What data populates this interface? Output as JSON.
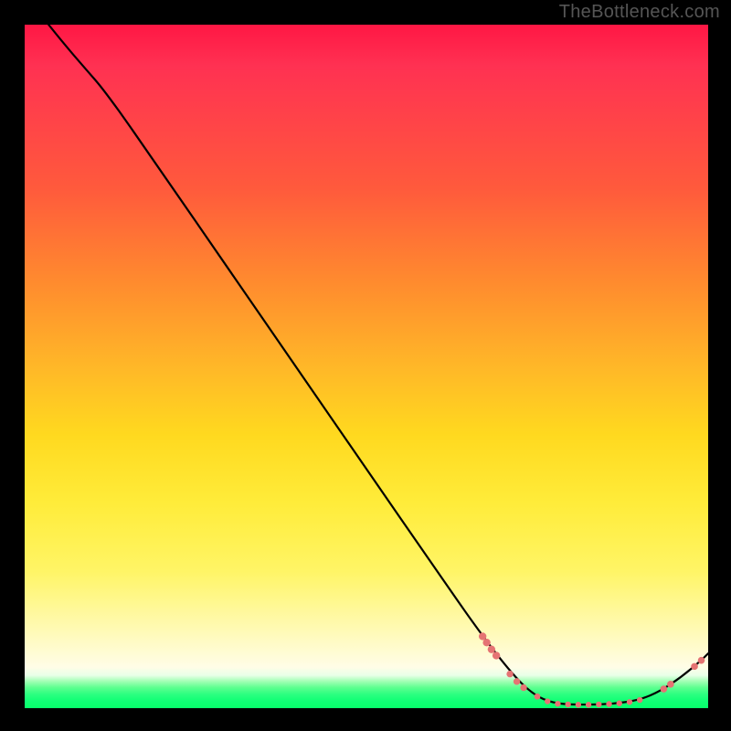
{
  "watermark": "TheBottleneck.com",
  "chart_data": {
    "type": "line",
    "title": "",
    "xlabel": "",
    "ylabel": "",
    "xlim": [
      0,
      100
    ],
    "ylim": [
      0,
      100
    ],
    "grid": false,
    "curve": [
      {
        "x": 3.5,
        "y": 100
      },
      {
        "x": 5.5,
        "y": 97.5
      },
      {
        "x": 8.5,
        "y": 94
      },
      {
        "x": 12,
        "y": 90
      },
      {
        "x": 20,
        "y": 78.5
      },
      {
        "x": 30,
        "y": 64
      },
      {
        "x": 40,
        "y": 49.5
      },
      {
        "x": 50,
        "y": 35
      },
      {
        "x": 60,
        "y": 20.5
      },
      {
        "x": 67,
        "y": 10.5
      },
      {
        "x": 72,
        "y": 4.2
      },
      {
        "x": 75,
        "y": 1.6
      },
      {
        "x": 78,
        "y": 0.6
      },
      {
        "x": 82,
        "y": 0.5
      },
      {
        "x": 86,
        "y": 0.6
      },
      {
        "x": 90,
        "y": 1.2
      },
      {
        "x": 93,
        "y": 2.5
      },
      {
        "x": 96,
        "y": 4.5
      },
      {
        "x": 99,
        "y": 7.0
      },
      {
        "x": 100,
        "y": 8.0
      }
    ],
    "markers": [
      {
        "x": 67.0,
        "y": 10.5,
        "r": 4.2
      },
      {
        "x": 67.6,
        "y": 9.6,
        "r": 4.2
      },
      {
        "x": 68.3,
        "y": 8.6,
        "r": 4.2
      },
      {
        "x": 69.0,
        "y": 7.7,
        "r": 4.2
      },
      {
        "x": 71.0,
        "y": 5.0,
        "r": 3.7
      },
      {
        "x": 72.0,
        "y": 3.9,
        "r": 3.7
      },
      {
        "x": 73.0,
        "y": 3.0,
        "r": 3.7
      },
      {
        "x": 75.0,
        "y": 1.7,
        "r": 3.4
      },
      {
        "x": 76.5,
        "y": 1.0,
        "r": 3.2
      },
      {
        "x": 78.0,
        "y": 0.65,
        "r": 3.2
      },
      {
        "x": 79.5,
        "y": 0.55,
        "r": 3.2
      },
      {
        "x": 81.0,
        "y": 0.5,
        "r": 3.2
      },
      {
        "x": 82.5,
        "y": 0.5,
        "r": 3.2
      },
      {
        "x": 84.0,
        "y": 0.55,
        "r": 3.2
      },
      {
        "x": 85.5,
        "y": 0.6,
        "r": 3.2
      },
      {
        "x": 87.0,
        "y": 0.7,
        "r": 3.2
      },
      {
        "x": 88.5,
        "y": 0.9,
        "r": 3.2
      },
      {
        "x": 90.0,
        "y": 1.2,
        "r": 3.2
      },
      {
        "x": 93.5,
        "y": 2.8,
        "r": 3.8
      },
      {
        "x": 94.5,
        "y": 3.5,
        "r": 3.8
      },
      {
        "x": 98.0,
        "y": 6.1,
        "r": 3.8
      },
      {
        "x": 99.0,
        "y": 7.0,
        "r": 3.8
      }
    ],
    "colors": {
      "curve": "#000000",
      "marker": "#e57373"
    }
  }
}
